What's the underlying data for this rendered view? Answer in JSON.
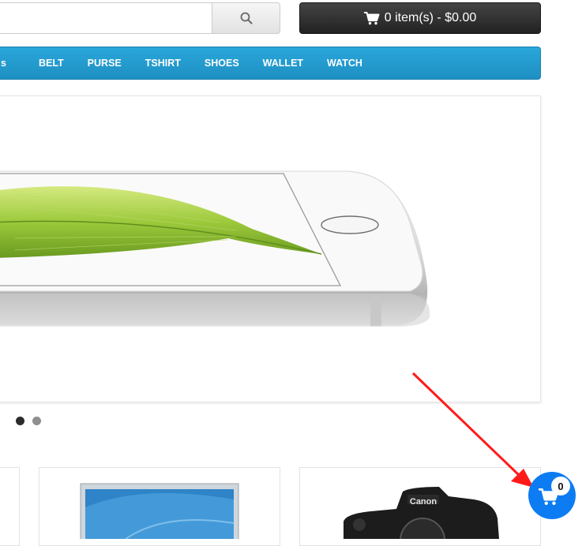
{
  "search": {
    "placeholder": "",
    "button_icon": "search-icon"
  },
  "cart": {
    "icon": "cart-icon",
    "label": "0 item(s) - $0.00"
  },
  "menu": {
    "items": [
      {
        "label": "s"
      },
      {
        "label": "BELT"
      },
      {
        "label": "PURSE"
      },
      {
        "label": "TSHIRT"
      },
      {
        "label": "SHOES"
      },
      {
        "label": "WALLET"
      },
      {
        "label": "WATCH"
      }
    ]
  },
  "slideshow": {
    "slide_count": 2,
    "active_slide": 0
  },
  "floating_cart": {
    "icon": "cart-icon",
    "count": "0"
  },
  "colors": {
    "menu": "#1e9bd1",
    "cart_button": "#2a2a2a",
    "floating_cart": "#0d7cf2",
    "arrow": "#ff1a1a"
  }
}
